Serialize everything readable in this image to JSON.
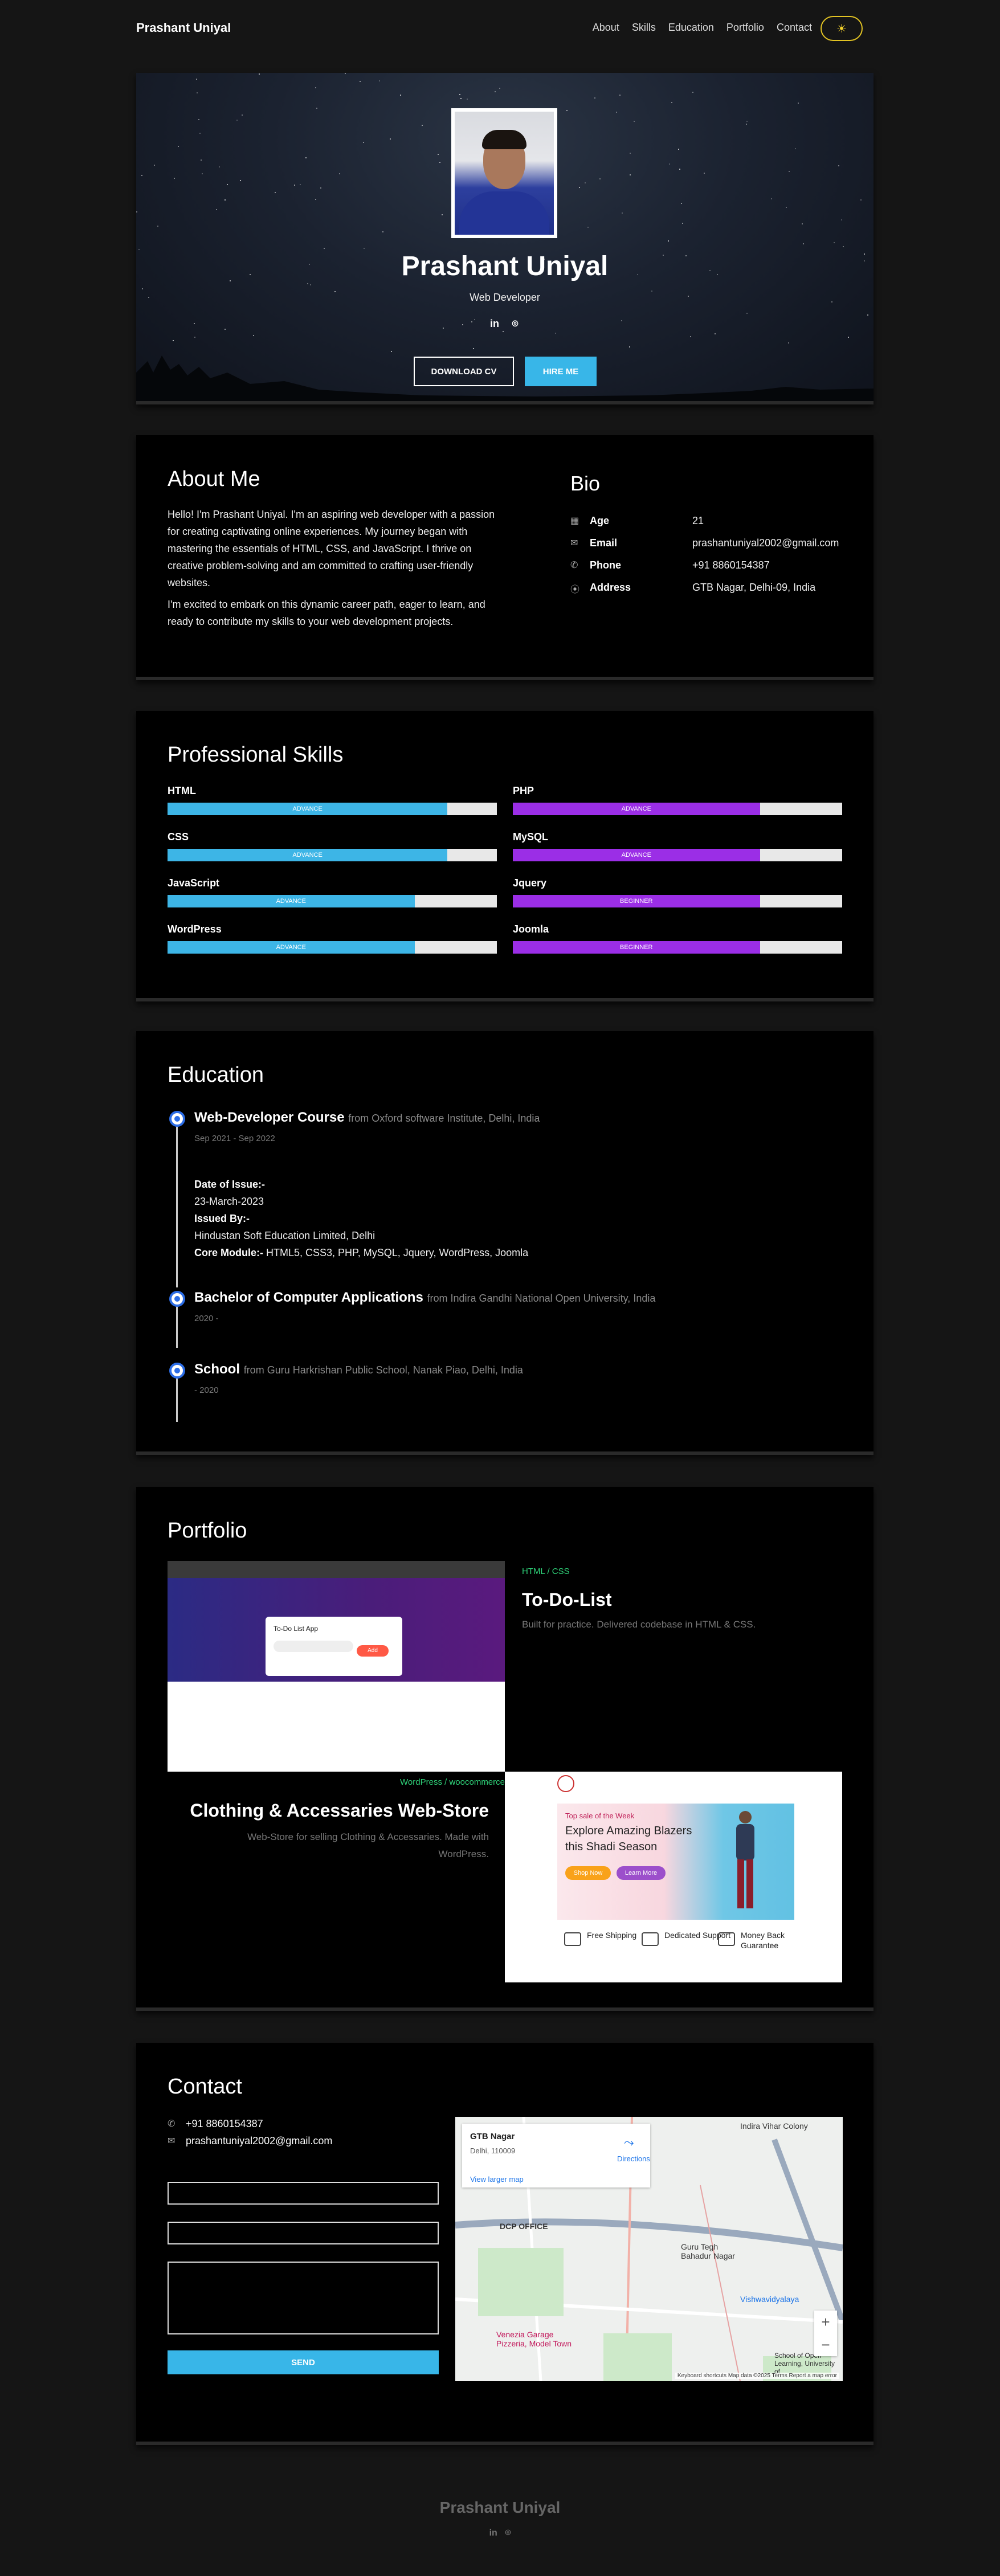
{
  "nav": {
    "brand": "Prashant Uniyal",
    "links": [
      "About",
      "Skills",
      "Education",
      "Portfolio",
      "Contact"
    ],
    "theme_icon": "sun-icon"
  },
  "hero": {
    "name": "Prashant Uniyal",
    "role": "Web Developer",
    "socials": [
      "linkedin-icon",
      "github-icon"
    ],
    "download_label": "DOWNLOAD CV",
    "hire_label": "HIRE ME"
  },
  "about": {
    "title": "About Me",
    "p1": "Hello! I'm Prashant Uniyal. I'm an aspiring web developer with a passion for creating captivating online experiences. My journey began with mastering the essentials of HTML, CSS, and JavaScript. I thrive on creative problem-solving and am committed to crafting user-friendly websites.",
    "p2": "I'm excited to embark on this dynamic career path, eager to learn, and ready to contribute my skills to your web development projects.",
    "bio_title": "Bio",
    "bio": [
      {
        "icon": "calendar-icon",
        "label": "Age",
        "value": "21"
      },
      {
        "icon": "envelope-icon",
        "label": "Email",
        "value": "prashantuniyal2002@gmail.com"
      },
      {
        "icon": "phone-icon",
        "label": "Phone",
        "value": "+91 8860154387"
      },
      {
        "icon": "map-pin-icon",
        "label": "Address",
        "value": "GTB Nagar, Delhi-09, India"
      }
    ]
  },
  "skills": {
    "title": "Professional Skills",
    "left": [
      {
        "name": "HTML",
        "level": "ADVANCE",
        "percent": 85
      },
      {
        "name": "CSS",
        "level": "ADVANCE",
        "percent": 85
      },
      {
        "name": "JavaScript",
        "level": "ADVANCE",
        "percent": 75
      },
      {
        "name": "WordPress",
        "level": "ADVANCE",
        "percent": 75
      }
    ],
    "right": [
      {
        "name": "PHP",
        "level": "ADVANCE",
        "percent": 75
      },
      {
        "name": "MySQL",
        "level": "ADVANCE",
        "percent": 75
      },
      {
        "name": "Jquery",
        "level": "BEGINNER",
        "percent": 75
      },
      {
        "name": "Joomla",
        "level": "BEGINNER",
        "percent": 75
      }
    ],
    "colors": {
      "left": "#3db5e6",
      "right": "#9b2ee6"
    }
  },
  "education": {
    "title": "Education",
    "items": [
      {
        "degree": "Web-Developer Course",
        "from": "from Oxford software Institute, Delhi, India",
        "date": "Sep 2021 - Sep 2022",
        "issue_label": "Date of Issue:-",
        "issue_value": "23-March-2023",
        "issued_by_label": "Issued By:-",
        "issued_by_value": "Hindustan Soft Education Limited, Delhi",
        "core_label": "Core Module:-",
        "core_value": "HTML5, CSS3, PHP, MySQL, Jquery, WordPress, Joomla"
      },
      {
        "degree": "Bachelor of Computer Applications",
        "from": "from Indira Gandhi National Open University, India",
        "date": "2020 -"
      },
      {
        "degree": "School",
        "from": "from Guru Harkrishan Public School, Nanak Piao, Delhi, India",
        "date": "- 2020"
      }
    ]
  },
  "portfolio": {
    "title": "Portfolio",
    "p1": {
      "category": "HTML / CSS",
      "title": "To-Do-List",
      "desc": "Built for practice. Delivered codebase in HTML & CSS.",
      "app_title": "To-Do List App",
      "add_label": "Add"
    },
    "p2": {
      "category": "WordPress / woocommerce",
      "title": "Clothing & Accessaries Web-Store",
      "desc": "Web-Store for selling Clothing & Accessaries. Made with WordPress.",
      "banner_top": "Top sale of the Week",
      "banner_head": "Explore Amazing Blazers this Shadi Season",
      "shop_now": "Shop Now",
      "learn_more": "Learn More",
      "features": [
        "Free Shipping",
        "Dedicated Support",
        "Money Back Guarantee"
      ]
    }
  },
  "contact": {
    "title": "Contact",
    "phone": "+91 8860154387",
    "email": "prashantuniyal2002@gmail.com",
    "send_label": "SEND",
    "map": {
      "place": "GTB Nagar",
      "address": "Delhi, 110009",
      "directions": "Directions",
      "larger_map": "View larger map",
      "footer": "Keyboard shortcuts  Map data ©2025  Terms  Report a map error",
      "labels": [
        "Indira Vihar Colony",
        "DCP OFFICE",
        "Guru Tegh Bahadur Nagar",
        "Vishwavidyalaya",
        "Venezia Garage Pizzeria, Model Town",
        "School of Open Learning, University of"
      ]
    }
  },
  "footer": {
    "name": "Prashant Uniyal",
    "socials": [
      "linkedin-icon",
      "github-icon"
    ]
  }
}
